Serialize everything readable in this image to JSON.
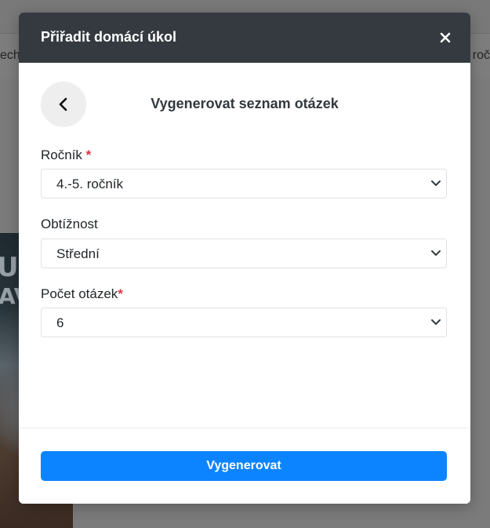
{
  "background": {
    "tab_left_text": "ech",
    "tab_right_text": "roč"
  },
  "modal": {
    "title": "Přiřadit domácí úkol",
    "close_icon": "close-icon",
    "back_icon": "chevron-left-icon",
    "subtitle": "Vygenerovat seznam otázek",
    "fields": [
      {
        "label": "Ročník",
        "required_mark": "*",
        "value": "4.-5. ročník"
      },
      {
        "label": "Obtížnost",
        "required_mark": "",
        "value": "Střední"
      },
      {
        "label": "Počet otázek",
        "required_mark": "*",
        "value": "6"
      }
    ],
    "submit_label": "Vygenerovat"
  },
  "colors": {
    "header_bg": "#353a40",
    "primary": "#0d84ff",
    "required": "#dc3545",
    "overlay": "#7b7b7b"
  }
}
